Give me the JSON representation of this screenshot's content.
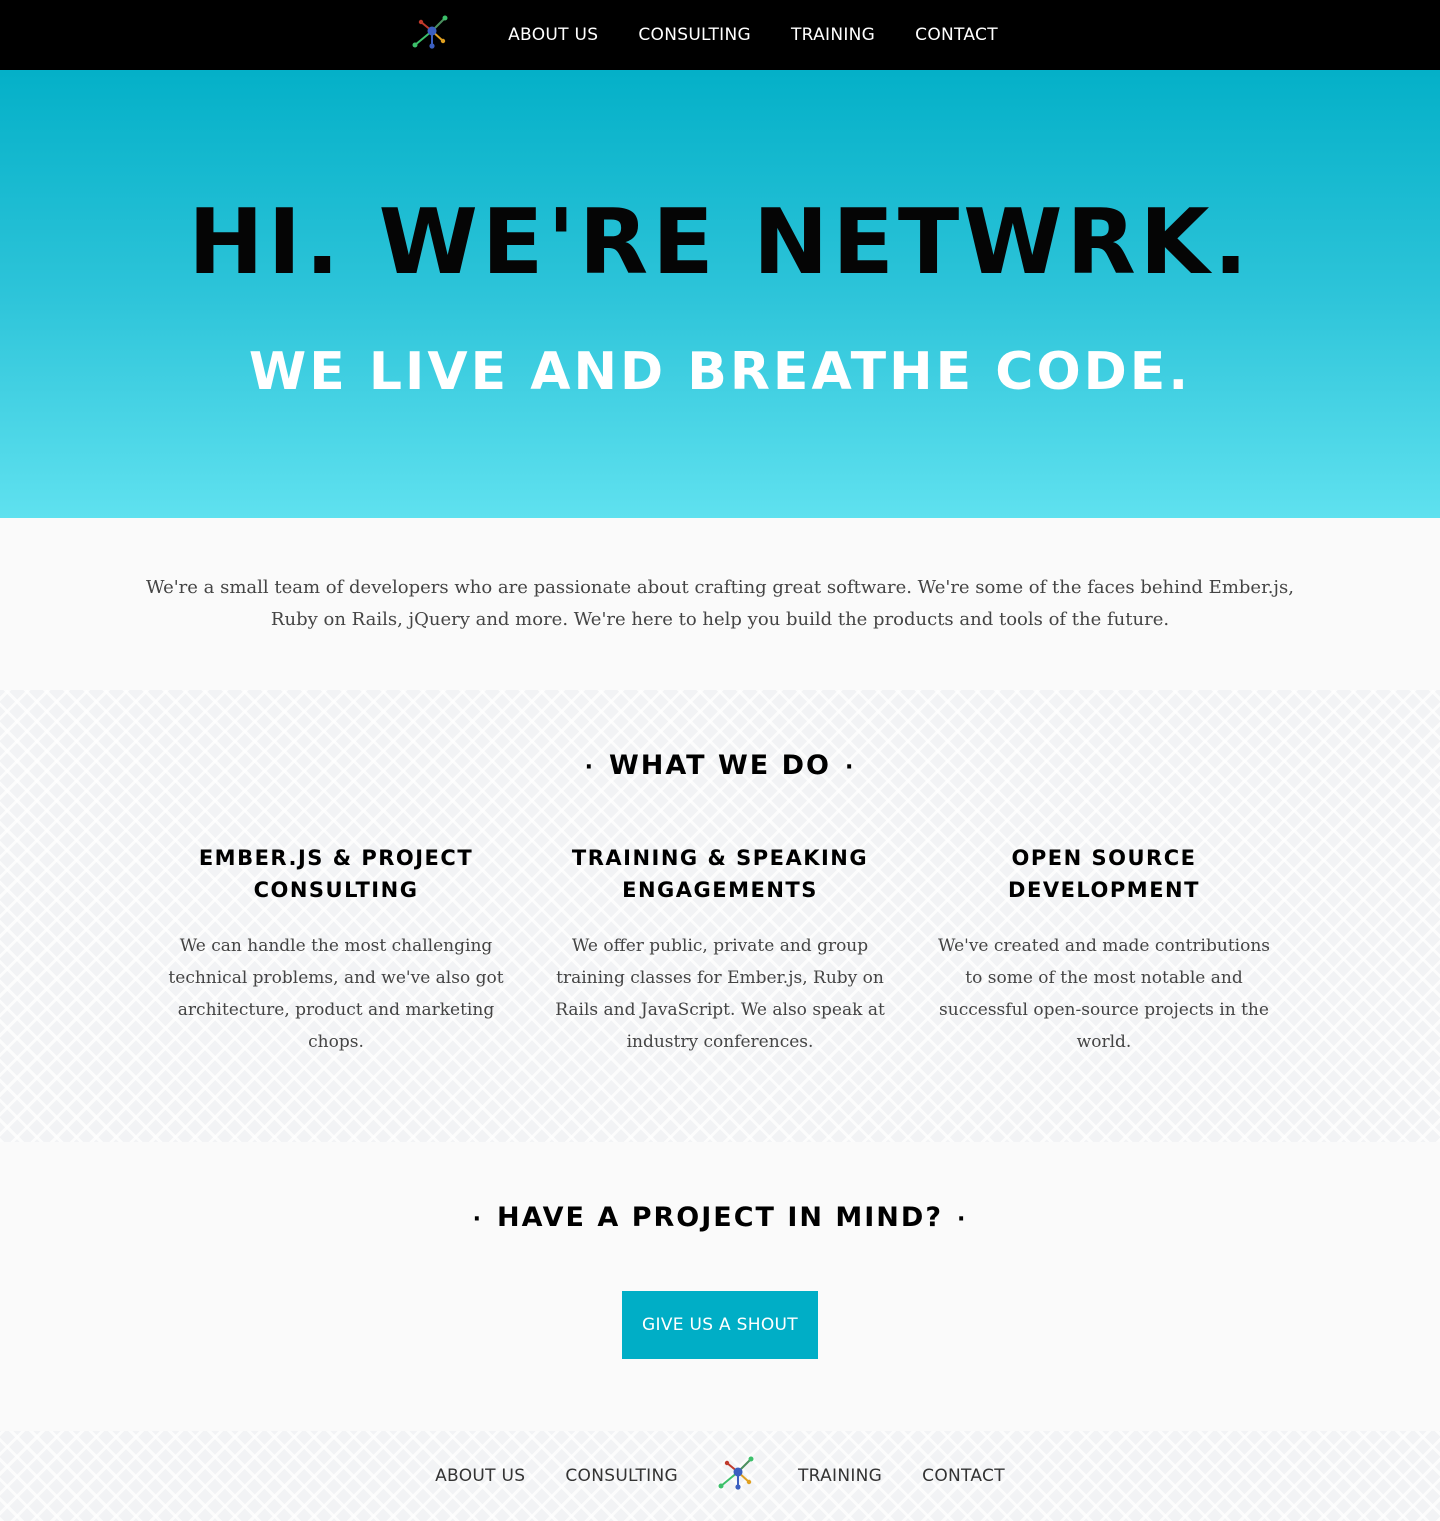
{
  "nav": {
    "items": [
      {
        "label": "ABOUT US"
      },
      {
        "label": "CONSULTING"
      },
      {
        "label": "TRAINING"
      },
      {
        "label": "CONTACT"
      }
    ]
  },
  "hero": {
    "title": "HI. WE'RE NETWRK.",
    "subtitle": "WE LIVE AND BREATHE CODE."
  },
  "intro": {
    "text": "We're a small team of developers who are passionate about crafting great software. We're some of the faces behind Ember.js, Ruby on Rails, jQuery and more. We're here to help you build the products and tools of the future."
  },
  "services": {
    "title": "WHAT WE DO",
    "items": [
      {
        "title": "EMBER.JS & PROJECT CONSULTING",
        "text": "We can handle the most challenging technical problems, and we've also got architecture, product and marketing chops."
      },
      {
        "title": "TRAINING & SPEAKING ENGAGEMENTS",
        "text": "We offer public, private and group training classes for Ember.js, Ruby on Rails and JavaScript. We also speak at industry conferences."
      },
      {
        "title": "OPEN SOURCE DEVELOPMENT",
        "text": "We've created and made contributions to some of the most notable and successful open-source projects in the world."
      }
    ]
  },
  "cta": {
    "title": "HAVE A PROJECT IN MIND?",
    "button_label": "GIVE US A SHOUT"
  },
  "footer": {
    "items": [
      {
        "label": "ABOUT US"
      },
      {
        "label": "CONSULTING"
      },
      {
        "label": "TRAINING"
      },
      {
        "label": "CONTACT"
      }
    ]
  },
  "colors": {
    "accent": "#00aec6",
    "nav_background": "#000000"
  },
  "icons": {
    "logo": "network-logo-icon"
  }
}
